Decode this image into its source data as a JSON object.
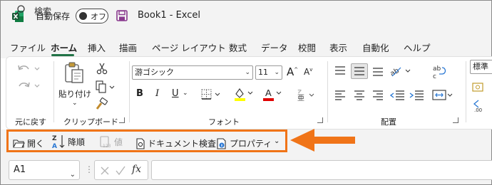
{
  "titlebar": {
    "autosave_label": "自動保存",
    "autosave_state": "オフ",
    "document_title": "Book1  -  Excel",
    "search_placeholder": "検索"
  },
  "tabs": [
    "ファイル",
    "ホーム",
    "挿入",
    "描画",
    "ページ レイアウト",
    "数式",
    "データ",
    "校閲",
    "表示",
    "自動化",
    "ヘルプ"
  ],
  "active_tab": "ホーム",
  "ribbon": {
    "undo_group": {
      "label": "元に戻す"
    },
    "clipboard": {
      "label": "クリップボード",
      "paste_label": "貼り付け"
    },
    "font": {
      "label": "フォント",
      "font_name": "游ゴシック",
      "font_size": "11",
      "bold": "B",
      "italic": "I",
      "underline": "U",
      "grow": "A",
      "shrink": "A"
    },
    "alignment": {
      "label": "配置"
    },
    "number": {
      "format": "標準"
    }
  },
  "qat": {
    "items": [
      {
        "label": "開く",
        "enabled": true
      },
      {
        "label": "降順",
        "enabled": true
      },
      {
        "label": "値",
        "enabled": false
      },
      {
        "label": "ドキュメント検査",
        "enabled": true
      },
      {
        "label": "プロパティ",
        "enabled": true
      }
    ]
  },
  "formula_bar": {
    "name_box": "A1",
    "fx": "fx",
    "formula": ""
  },
  "colors": {
    "excel_green": "#217346",
    "highlight_orange": "#f07418",
    "fill_yellow": "#ffff00",
    "font_red": "#e00000"
  }
}
